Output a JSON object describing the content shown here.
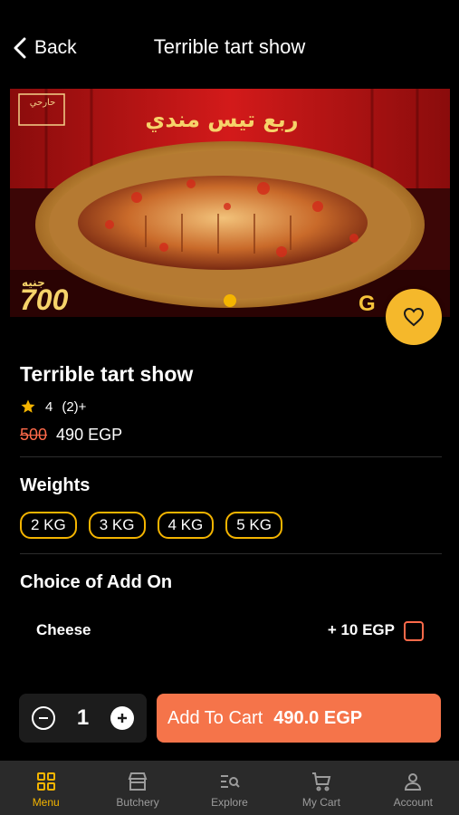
{
  "header": {
    "back_label": "Back",
    "title": "Terrible tart show"
  },
  "banner": {
    "arabic_title": "ربع تيس مندي",
    "price_text": "700",
    "currency_label": "جنيه",
    "brand_text": "G",
    "logo_text": "حارحي"
  },
  "product": {
    "name": "Terrible tart show",
    "rating": "4",
    "reviews": "(2)+",
    "old_price": "500",
    "price": "490 EGP"
  },
  "weights": {
    "title": "Weights",
    "options": [
      "2 KG",
      "3 KG",
      "4 KG",
      "5 KG"
    ]
  },
  "addons": {
    "title": "Choice of Add On",
    "items": [
      {
        "label": "Cheese",
        "price": "+ 10 EGP",
        "checked": false
      }
    ]
  },
  "cart": {
    "quantity": "1",
    "add_label": "Add To Cart",
    "total": "490.0 EGP"
  },
  "tabbar": {
    "items": [
      {
        "label": "Menu",
        "icon": "grid-icon",
        "active": true
      },
      {
        "label": "Butchery",
        "icon": "store-icon",
        "active": false
      },
      {
        "label": "Explore",
        "icon": "search-list-icon",
        "active": false
      },
      {
        "label": "My Cart",
        "icon": "cart-icon",
        "active": false
      },
      {
        "label": "Account",
        "icon": "person-icon",
        "active": false
      }
    ]
  },
  "colors": {
    "accent": "#f4b400",
    "cta": "#f5744a",
    "strike": "#ff6a4a"
  }
}
